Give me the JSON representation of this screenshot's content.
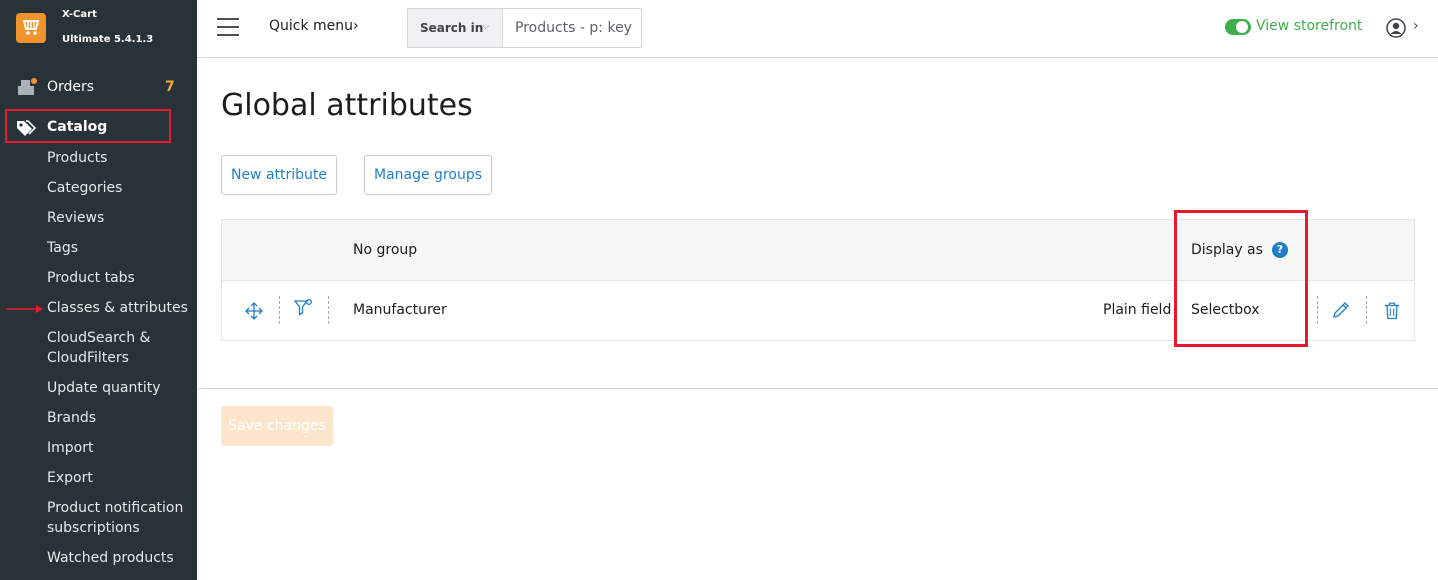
{
  "app": {
    "name": "X-Cart",
    "version": "Ultimate 5.4.1.3"
  },
  "sidebar": {
    "orders": {
      "label": "Orders",
      "badge": "7",
      "icon": "orders-icon"
    },
    "catalog": {
      "label": "Catalog",
      "icon": "tags-icon"
    },
    "catalog_items": [
      "Products",
      "Categories",
      "Reviews",
      "Tags",
      "Product tabs",
      "Classes & attributes",
      "CloudSearch & CloudFilters",
      "Update quantity",
      "Brands",
      "Import",
      "Export",
      "Product notification subscriptions",
      "Watched products"
    ]
  },
  "header": {
    "quick_menu": "Quick menu",
    "search_in": "Search in",
    "search_placeholder": "Products - p: key",
    "view_storefront": "View storefront"
  },
  "main": {
    "title": "Global attributes",
    "new_attribute": "New attribute",
    "manage_groups": "Manage groups",
    "table": {
      "group_header": "No group",
      "display_header": "Display as",
      "help": "?",
      "rows": [
        {
          "name": "Manufacturer",
          "type": "Plain field",
          "display": "Selectbox"
        }
      ]
    },
    "save_changes": "Save changes"
  },
  "colors": {
    "sidebar_bg": "#283339",
    "accent_orange": "#f0932d",
    "link_blue": "#1f7ec9",
    "storefront_green": "#3eae4d",
    "highlight_red": "#e8192c"
  }
}
